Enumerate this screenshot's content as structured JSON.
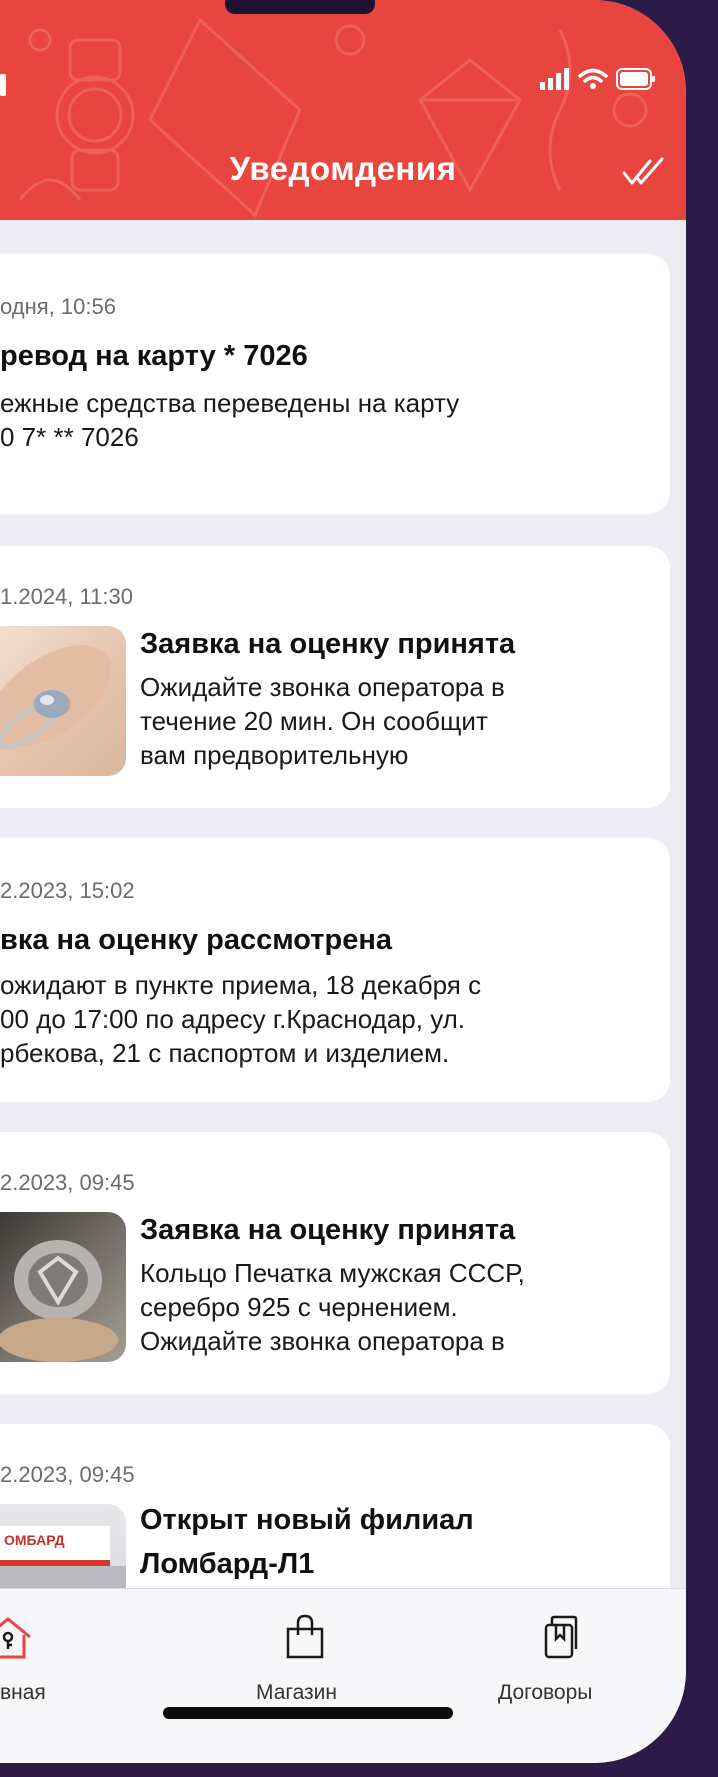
{
  "header": {
    "title": "Уведомдения",
    "read_all_icon": "double-check-icon",
    "color": "#e8453f"
  },
  "status_bar": {
    "icons": [
      "signal-icon",
      "wifi-icon",
      "battery-icon"
    ]
  },
  "notifications": [
    {
      "date": "одня, 10:56",
      "title": "ревод на карту * 7026",
      "text": [
        "ежные средства переведены на карту",
        "0 7* ** 7026"
      ],
      "image": null
    },
    {
      "date": "1.2024, 11:30",
      "title": "Заявка на оценку принята",
      "text": [
        "Ожидайте звонка оператора в",
        "течение 20 мин. Он сообщит",
        "вам предворительную"
      ],
      "image": "ring-photo"
    },
    {
      "date": "2.2023, 15:02",
      "title": "вка на оценку рассмотрена",
      "text": [
        "ожидают в пункте приема, 18 декабря с",
        "00 до 17:00 по адресу г.Краснодар, ул.",
        "рбекова, 21 с паспортом и изделием."
      ],
      "image": null
    },
    {
      "date": "2.2023, 09:45",
      "title": "Заявка на оценку принята",
      "text": [
        "Кольцо Печатка мужская СССР,",
        "серебро 925 с чернением.",
        "Ожидайте звонка оператора в"
      ],
      "image": "signet-ring-photo"
    },
    {
      "date": "2.2023, 09:45",
      "title_lines": [
        "Открыт новый филиал",
        "Ломбард-Л1"
      ],
      "image": "branch-photo",
      "sign_text": "ОМБАРД"
    }
  ],
  "tabbar": {
    "tabs": [
      {
        "label": "вная",
        "icon": "home-icon",
        "active": true
      },
      {
        "label": "Магазин",
        "icon": "shopping-bag-icon",
        "active": false
      },
      {
        "label": "Договоры",
        "icon": "documents-icon",
        "active": false
      }
    ],
    "active_color": "#e8453f"
  }
}
